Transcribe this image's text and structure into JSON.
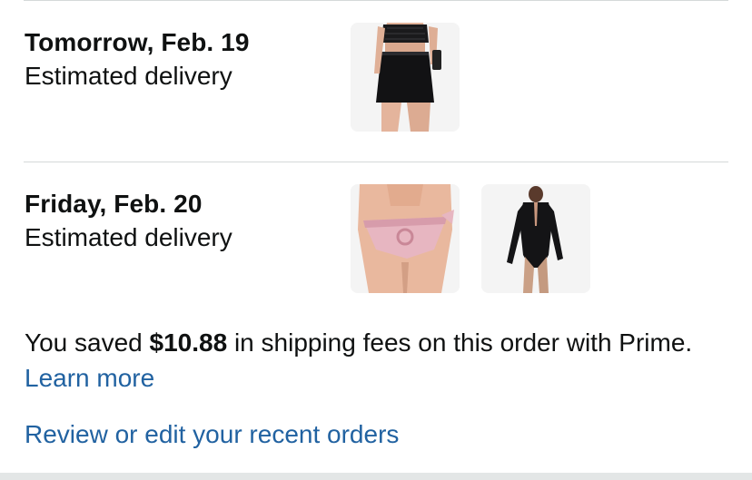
{
  "deliveries": [
    {
      "date": "Tomorrow, Feb. 19",
      "label": "Estimated delivery",
      "items": [
        "black-mini-skirt-thumbnail"
      ]
    },
    {
      "date": "Friday, Feb. 20",
      "label": "Estimated delivery",
      "items": [
        "pink-bikini-bottom-thumbnail",
        "black-bodysuit-thumbnail"
      ]
    }
  ],
  "savings": {
    "prefix": "You saved ",
    "amount": "$10.88",
    "suffix": " in shipping fees on this order with Prime. ",
    "learn_more": "Learn more"
  },
  "review_link": "Review or edit your recent orders",
  "colors": {
    "link": "#2162a1",
    "text": "#0f1111",
    "divider": "#d5d9d9",
    "thumb_bg": "#f4f4f4"
  }
}
